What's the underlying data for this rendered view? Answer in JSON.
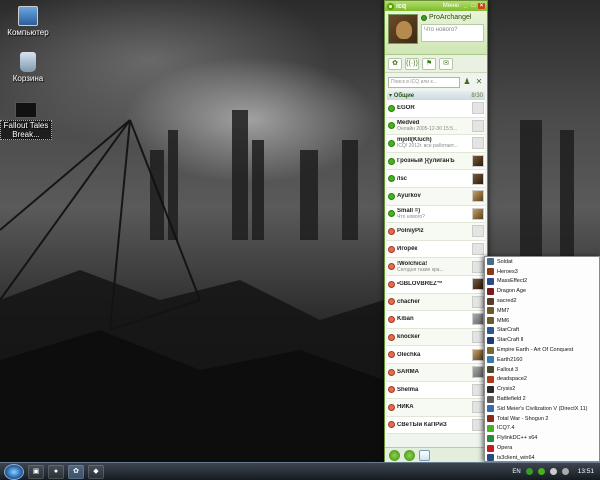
{
  "desktop": {
    "icons": [
      {
        "label": "Компьютер"
      },
      {
        "label": "Корзина"
      },
      {
        "label": "Fallout Tales Break..."
      }
    ]
  },
  "icq": {
    "title": "icq",
    "menu_label": "Меню",
    "profile": {
      "name": "ProArchangel",
      "mood_placeholder": "Что нового?"
    },
    "search": {
      "placeholder": "Поиск в ICQ или к..."
    },
    "group": {
      "name": "Общие",
      "count": "8/30"
    },
    "contacts": [
      {
        "name": "EGOR",
        "sub": "",
        "status": "online",
        "avatar": "blank"
      },
      {
        "name": "Medved",
        "sub": "Онлайн 2005-12-30 15:5...",
        "status": "online",
        "avatar": "blank"
      },
      {
        "name": "mjolI(Kluch)",
        "sub": "ICQ! 2012г. все работает...",
        "status": "online",
        "avatar": "blank"
      },
      {
        "name": "Грозный }{улиганЪ",
        "sub": "",
        "status": "online",
        "avatar": "dark"
      },
      {
        "name": "/lsc",
        "sub": "",
        "status": "online",
        "avatar": "dark"
      },
      {
        "name": "Ayurkov",
        "sub": "",
        "status": "online",
        "avatar": "photo"
      },
      {
        "name": "Small =)",
        "sub": "Что нового?",
        "status": "online",
        "avatar": "photo"
      },
      {
        "name": "PolniyPiz",
        "sub": "",
        "status": "offline",
        "avatar": "blank"
      },
      {
        "name": "Игорёк",
        "sub": "",
        "status": "offline",
        "avatar": "blank"
      },
      {
        "name": "!Wolchica!",
        "sub": "Сегодня такие кра...",
        "status": "offline",
        "avatar": "blank"
      },
      {
        "name": "•GBLOVBREZ™",
        "sub": "",
        "status": "offline",
        "avatar": "dark"
      },
      {
        "name": "chacher",
        "sub": "",
        "status": "offline",
        "avatar": "blank"
      },
      {
        "name": "Kiban",
        "sub": "",
        "status": "offline",
        "avatar": "gray"
      },
      {
        "name": "knocker",
        "sub": "",
        "status": "offline",
        "avatar": "blank"
      },
      {
        "name": "Olechka",
        "sub": "",
        "status": "offline",
        "avatar": "photo"
      },
      {
        "name": "SARMA",
        "sub": "",
        "status": "offline",
        "avatar": "gray"
      },
      {
        "name": "Shelma",
        "sub": "",
        "status": "offline",
        "avatar": "blank"
      },
      {
        "name": "НИКА",
        "sub": "",
        "status": "offline",
        "avatar": "blank"
      },
      {
        "name": "СВеТЫи КаПРиЗ",
        "sub": "",
        "status": "offline",
        "avatar": "blank"
      }
    ]
  },
  "jumplist": {
    "items": [
      {
        "label": "Soldat",
        "color": "#4a6a8a"
      },
      {
        "label": "Heroes3",
        "color": "#8a3a1a"
      },
      {
        "label": "MassEffect2",
        "color": "#2a4a8a"
      },
      {
        "label": "Dragon Age",
        "color": "#7a1a1a"
      },
      {
        "label": "sacred2",
        "color": "#5a3a2a"
      },
      {
        "label": "MM7",
        "color": "#6a5a2a"
      },
      {
        "label": "MM6",
        "color": "#6a5a2a"
      },
      {
        "label": "StarCraft",
        "color": "#2a5a8a"
      },
      {
        "label": "StarCraft II",
        "color": "#1a3a7a"
      },
      {
        "label": "Empire Earth - Art Of Conquest",
        "color": "#7a6a2a"
      },
      {
        "label": "Earth2160",
        "color": "#3a7aaa"
      },
      {
        "label": "Fallout 3",
        "color": "#4a4a2a"
      },
      {
        "label": "deadspace2",
        "color": "#aa3a1a"
      },
      {
        "label": "Crysis2",
        "color": "#2a2a2a"
      },
      {
        "label": "Battlefield 2",
        "color": "#5a5a5a"
      },
      {
        "label": "Sid Meier's Civilization V (DirectX 11)",
        "color": "#3a6aaa"
      },
      {
        "label": "Total War - Shogun 2",
        "color": "#8a2a1a"
      },
      {
        "label": "ICQ7.4",
        "color": "#4ab01e"
      },
      {
        "label": "FlylinkDC++ x64",
        "color": "#2a8a3a"
      },
      {
        "label": "Opera",
        "color": "#cc1a1a"
      },
      {
        "label": "ts3client_win64",
        "color": "#2a4a7a"
      },
      {
        "label": "DAEMON",
        "color": "#3a3a8a"
      }
    ]
  },
  "taskbar": {
    "language": "EN",
    "clock": "13:51"
  }
}
